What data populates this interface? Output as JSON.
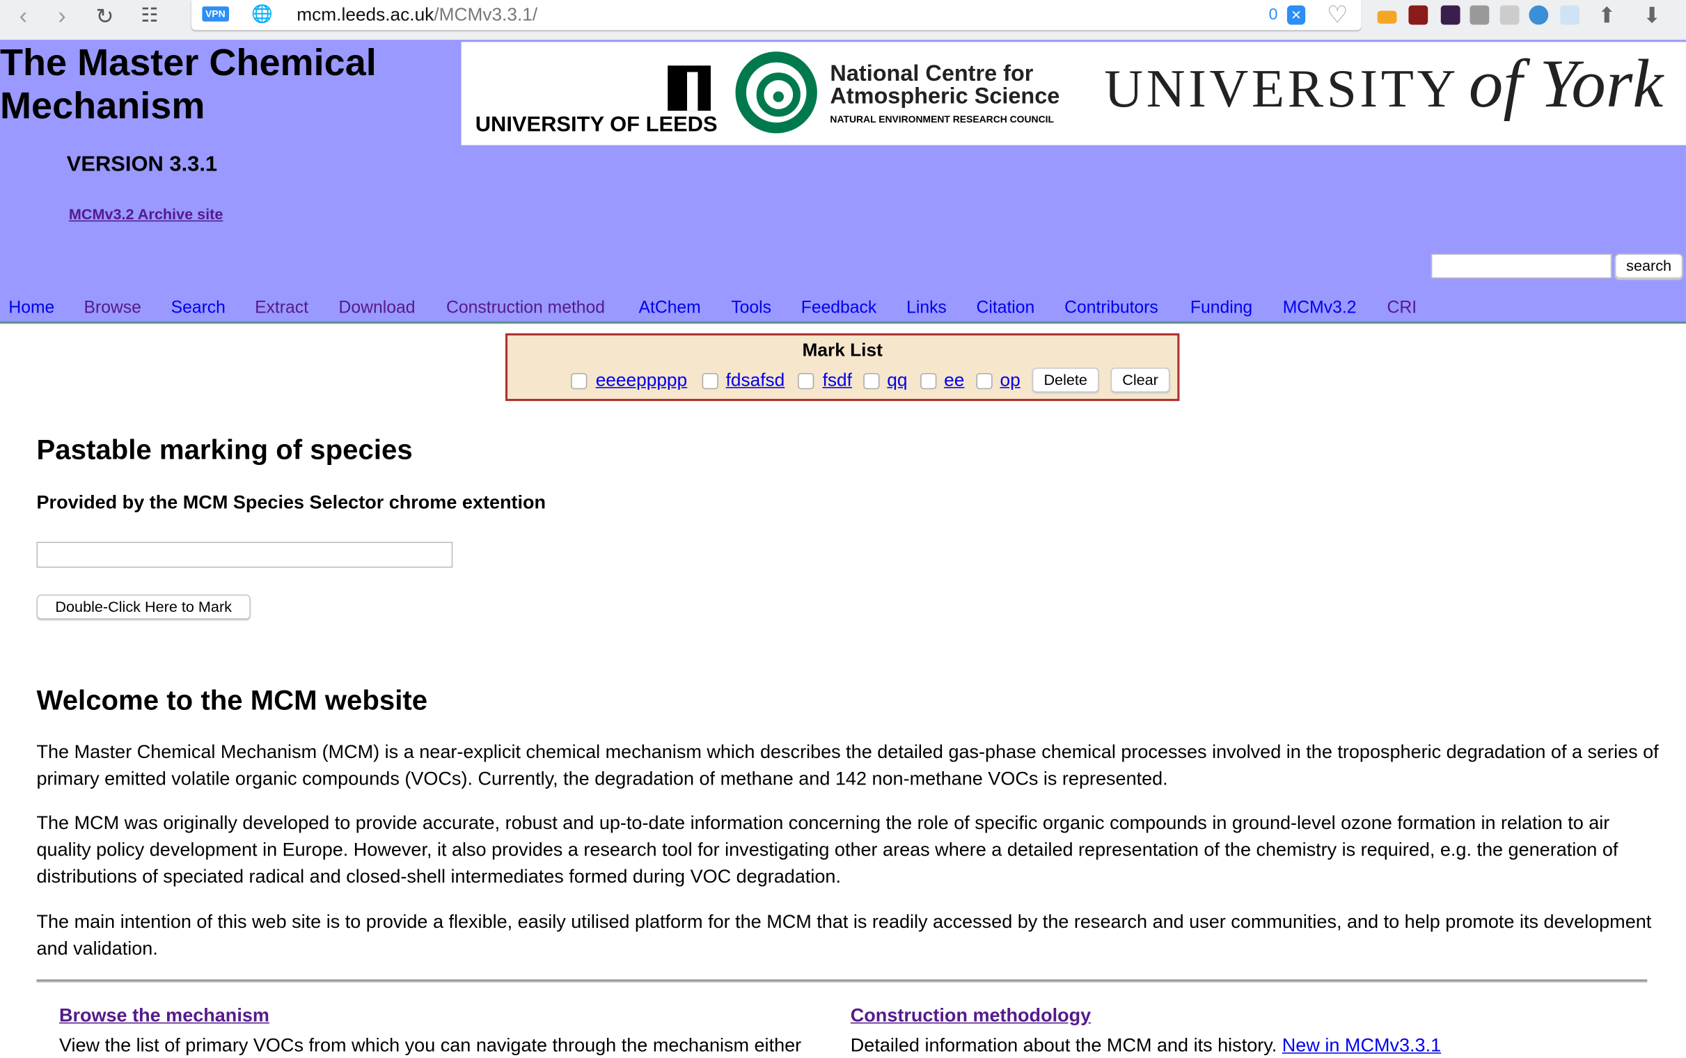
{
  "browser": {
    "url_host": "mcm.leeds.ac.uk",
    "url_path": "/MCMv3.3.1/",
    "vpn_badge": "VPN",
    "shield_count": "0"
  },
  "header": {
    "title_line1": "The Master Chemical",
    "title_line2": "Mechanism",
    "version": "VERSION 3.3.1",
    "archive_link": "MCMv3.2 Archive site",
    "search_value": "",
    "search_button": "search",
    "logos": {
      "leeds": "UNIVERSITY OF LEEDS",
      "ncas_line1": "National Centre for",
      "ncas_line2": "Atmospheric Science",
      "ncas_sub": "NATURAL ENVIRONMENT RESEARCH COUNCIL",
      "york_main": "UNIVERSITY",
      "york_script": "of York"
    }
  },
  "nav": [
    {
      "label": "Home",
      "visited": false
    },
    {
      "label": "Browse",
      "visited": true
    },
    {
      "label": "Search",
      "visited": false
    },
    {
      "label": "Extract",
      "visited": true
    },
    {
      "label": "Download",
      "visited": true
    },
    {
      "label": "Construction method",
      "visited": true
    },
    {
      "label": "AtChem",
      "visited": false
    },
    {
      "label": "Tools",
      "visited": false
    },
    {
      "label": "Feedback",
      "visited": false
    },
    {
      "label": "Links",
      "visited": false
    },
    {
      "label": "Citation",
      "visited": false
    },
    {
      "label": "Contributors",
      "visited": false
    },
    {
      "label": "Funding",
      "visited": false
    },
    {
      "label": "MCMv3.2",
      "visited": false
    },
    {
      "label": "CRI",
      "visited": true
    }
  ],
  "mark_list": {
    "title": "Mark List",
    "items": [
      "eeeeppppp",
      "fdsafsd",
      "fsdf",
      "qq",
      "ee",
      "op"
    ],
    "delete": "Delete",
    "clear": "Clear"
  },
  "pastable": {
    "heading": "Pastable marking of species",
    "subheading": "Provided by the MCM Species Selector chrome extention",
    "input_value": "",
    "button": "Double-Click Here to Mark"
  },
  "welcome": {
    "heading": "Welcome to the MCM website",
    "p1": "The Master Chemical Mechanism (MCM) is a near-explicit chemical mechanism which describes the detailed gas-phase chemical processes involved in the tropospheric degradation of a series of primary emitted volatile organic compounds (VOCs). Currently, the degradation of methane and 142 non-methane VOCs is represented.",
    "p2": "The MCM was originally developed to provide accurate, robust and up-to-date information concerning the role of specific organic compounds in ground-level ozone formation in relation to air quality policy development in Europe. However, it also provides a research tool for investigating other areas where a detailed representation of the chemistry is required, e.g. the generation of distributions of speciated radical and closed-shell intermediates formed during VOC degradation.",
    "p3": "The main intention of this web site is to provide a flexible, easily utilised platform for the MCM that is readily accessed by the research and user communities, and to help promote its development and validation."
  },
  "sections": {
    "browse_title": "Browse the mechanism",
    "browse_text": "View the list of primary VOCs from which you can navigate through the mechanism either",
    "construction_title": "Construction methodology",
    "construction_text": "Detailed information about the MCM and its history.",
    "construction_link": "New in MCMv3.3.1"
  },
  "colors": {
    "header_bg": "#9999ff",
    "link": "#0000ee",
    "visited": "#551a8b",
    "marklist_bg": "#f5e6cc",
    "marklist_border": "#b03030"
  }
}
